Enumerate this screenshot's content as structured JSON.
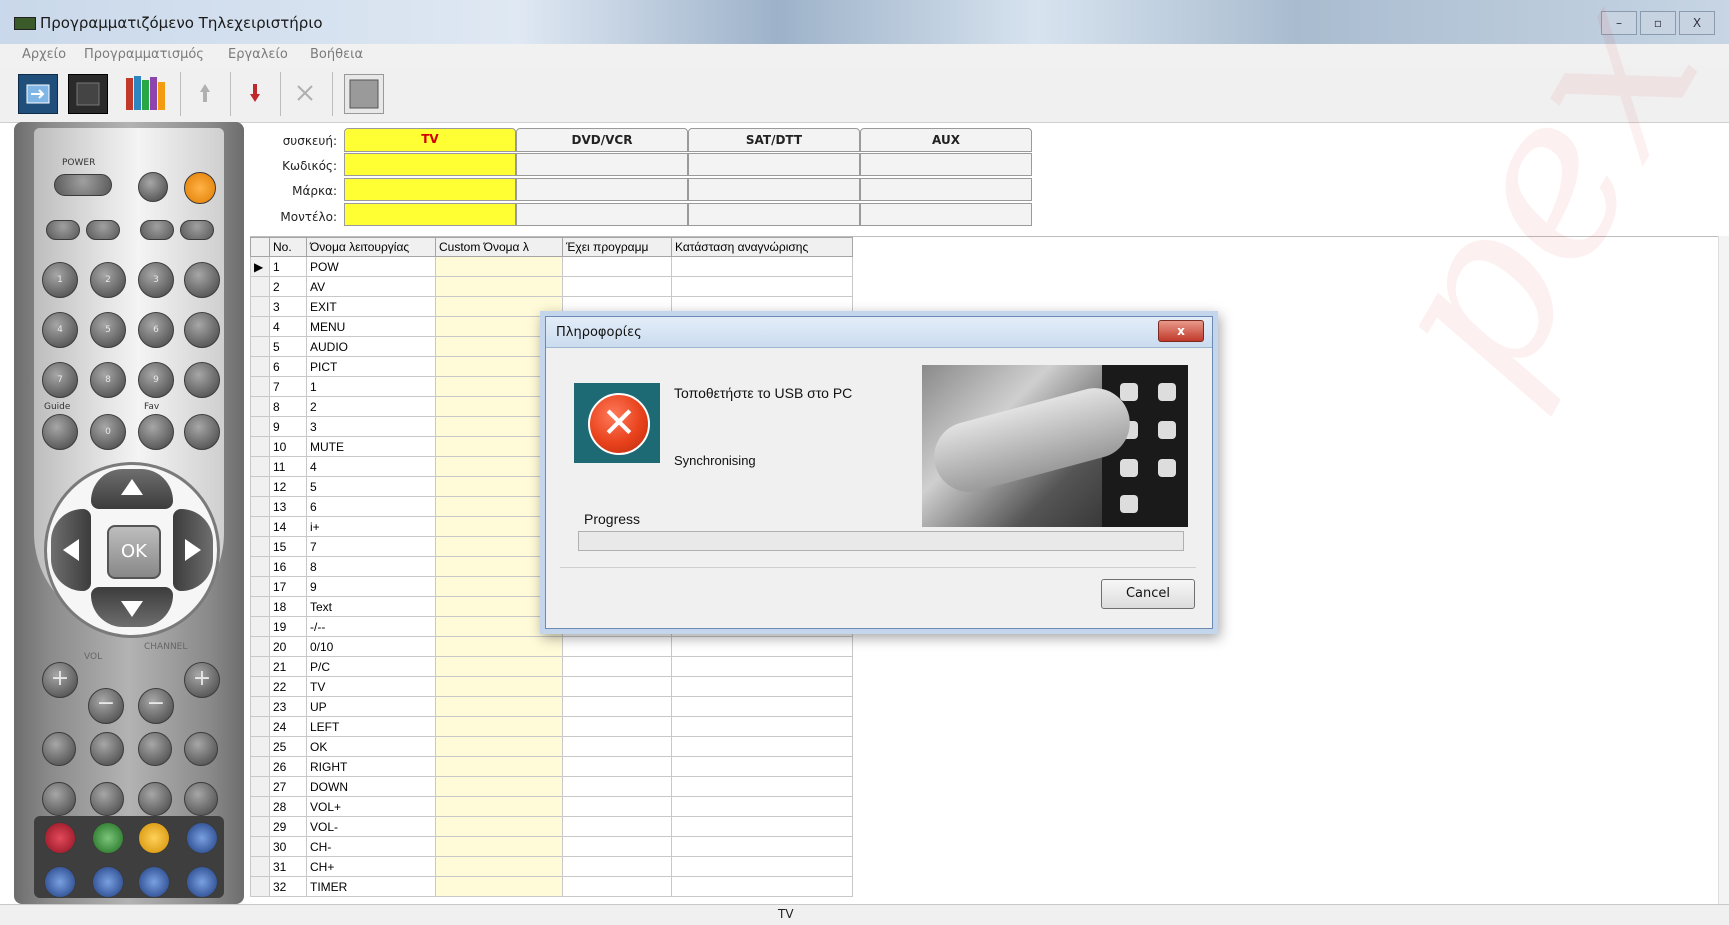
{
  "window": {
    "title": "Προγραμματιζόμενο Τηλεχειριστήριο",
    "buttons": [
      "–",
      "▫",
      "X"
    ]
  },
  "menu": [
    "Αρχείο",
    "Προγραμματισμός",
    "Εργαλείο",
    "Βοήθεια"
  ],
  "remote": {
    "power_label": "POWER",
    "guide_label": "Guide",
    "fav_label": "Fav",
    "ok_label": "OK",
    "vol_label": "VOL",
    "channel_label": "CHANNEL",
    "num_keys": [
      "1",
      "2",
      "3",
      "4",
      "5",
      "6",
      "7",
      "8",
      "9",
      "0"
    ]
  },
  "device_header": {
    "labels": {
      "device": "συσκευή:",
      "code": "Κωδικός:",
      "brand": "Μάρκα:",
      "model": "Μοντέλο:"
    },
    "tabs": [
      "TV",
      "DVD/VCR",
      "SAT/DTT",
      "AUX"
    ]
  },
  "table": {
    "columns": [
      "No.",
      "Όνομα λειτουργίας",
      "Custom Όνομα λ",
      "Έχει προγραμμ",
      "Κατάσταση αναγνώρισης"
    ],
    "rows": [
      [
        "1",
        "POW"
      ],
      [
        "2",
        "AV"
      ],
      [
        "3",
        "EXIT"
      ],
      [
        "4",
        "MENU"
      ],
      [
        "5",
        "AUDIO"
      ],
      [
        "6",
        "PICT"
      ],
      [
        "7",
        "1"
      ],
      [
        "8",
        "2"
      ],
      [
        "9",
        "3"
      ],
      [
        "10",
        "MUTE"
      ],
      [
        "11",
        "4"
      ],
      [
        "12",
        "5"
      ],
      [
        "13",
        "6"
      ],
      [
        "14",
        "i+"
      ],
      [
        "15",
        "7"
      ],
      [
        "16",
        "8"
      ],
      [
        "17",
        "9"
      ],
      [
        "18",
        "Text"
      ],
      [
        "19",
        "-/--"
      ],
      [
        "20",
        "0/10"
      ],
      [
        "21",
        "P/C"
      ],
      [
        "22",
        "TV"
      ],
      [
        "23",
        "UP"
      ],
      [
        "24",
        "LEFT"
      ],
      [
        "25",
        "OK"
      ],
      [
        "26",
        "RIGHT"
      ],
      [
        "27",
        "DOWN"
      ],
      [
        "28",
        "VOL+"
      ],
      [
        "29",
        "VOL-"
      ],
      [
        "30",
        "CH-"
      ],
      [
        "31",
        "CH+"
      ],
      [
        "32",
        "TIMER"
      ]
    ]
  },
  "dialog": {
    "title": "Πληροφορίες",
    "close": "x",
    "message": "Τοποθετήστε το USB στο PC",
    "status": "Synchronising",
    "progress_label": "Progress",
    "progress_value": 0,
    "cancel_label": "Cancel"
  },
  "watermark": "pex S.A.",
  "statusbar": {
    "device": "TV"
  }
}
